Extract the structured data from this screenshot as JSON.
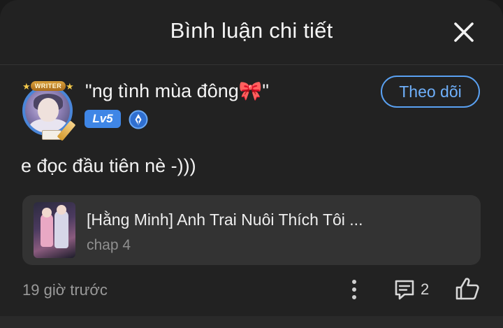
{
  "header": {
    "title": "Bình luận chi tiết"
  },
  "author": {
    "badge_text": "WRITER",
    "name": "\"ng tình mùa đông🎀\"",
    "level": "Lv5"
  },
  "follow_button": {
    "label": "Theo dõi"
  },
  "comment": {
    "text": "e đọc đầu tiên nè -)))"
  },
  "story": {
    "title": "[Hằng Minh] Anh Trai Nuôi Thích Tôi ...",
    "chapter": "chap 4"
  },
  "footer": {
    "timestamp": "19 giờ trước",
    "reply_count": "2"
  },
  "colors": {
    "background": "#222222",
    "accent_blue": "#5aa1f2",
    "level_badge": "#3f86e6",
    "card": "#333333"
  },
  "icons": {
    "close": "close-icon",
    "writer": "writer-pen-icon",
    "more": "more-vertical-icon",
    "reply": "comment-icon",
    "like": "thumbs-up-icon"
  }
}
